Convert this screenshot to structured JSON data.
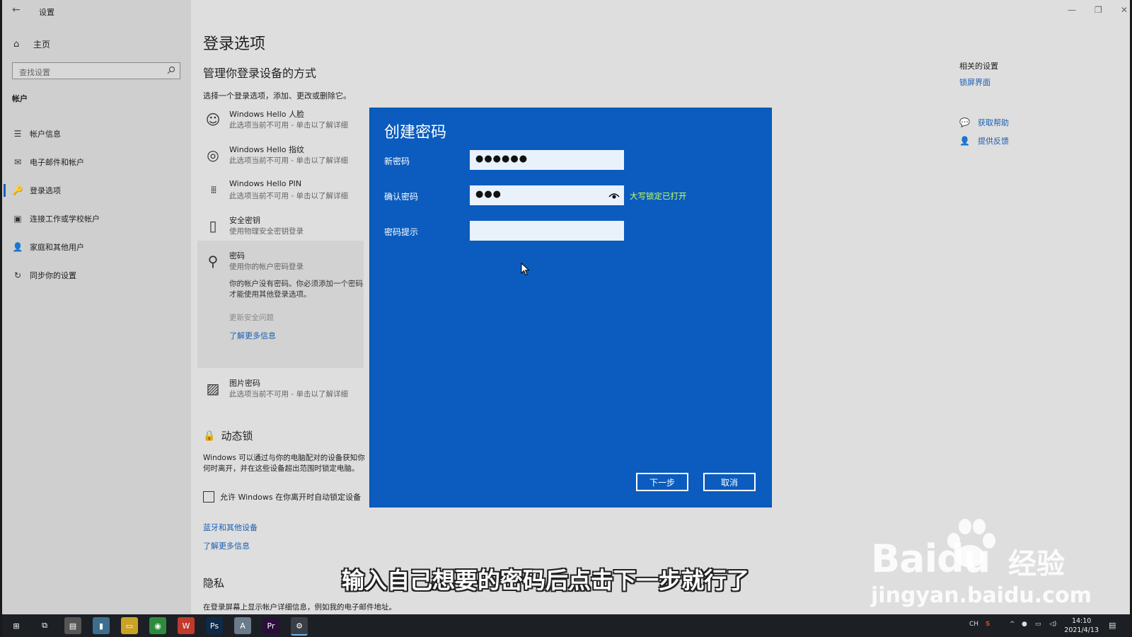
{
  "window": {
    "title": "设置",
    "back_glyph": "←",
    "controls": [
      "—",
      "❐",
      "✕"
    ]
  },
  "sidebar": {
    "home": "主页",
    "search_placeholder": "查找设置",
    "section": "帐户",
    "items": [
      {
        "label": "帐户信息",
        "icon": "account-info-icon",
        "glyph": "☰"
      },
      {
        "label": "电子邮件和帐户",
        "icon": "email-icon",
        "glyph": "✉"
      },
      {
        "label": "登录选项",
        "icon": "key-icon",
        "glyph": "🔑"
      },
      {
        "label": "连接工作或学校帐户",
        "icon": "briefcase-icon",
        "glyph": "▣"
      },
      {
        "label": "家庭和其他用户",
        "icon": "person-icon",
        "glyph": "👤"
      },
      {
        "label": "同步你的设置",
        "icon": "sync-icon",
        "glyph": "↻"
      }
    ]
  },
  "main": {
    "title": "登录选项",
    "subtitle": "管理你登录设备的方式",
    "intro": "选择一个登录选项，添加、更改或删除它。",
    "options": [
      {
        "title": "Windows Hello 人脸",
        "desc": "此选项当前不可用 - 单击以了解详细",
        "icon": "face-icon",
        "glyph": "☺"
      },
      {
        "title": "Windows Hello 指纹",
        "desc": "此选项当前不可用 - 单击以了解详细",
        "icon": "fingerprint-icon",
        "glyph": "◎"
      },
      {
        "title": "Windows Hello PIN",
        "desc": "此选项当前不可用 - 单击以了解详细",
        "icon": "pin-icon",
        "glyph": "⁞⁞⁞"
      },
      {
        "title": "安全密钥",
        "desc": "使用物理安全密钥登录",
        "icon": "usb-key-icon",
        "glyph": "▯"
      },
      {
        "title": "密码",
        "desc": "使用你的帐户密码登录",
        "icon": "password-key-icon",
        "glyph": "⚲"
      },
      {
        "title": "图片密码",
        "desc": "此选项当前不可用 - 单击以了解详细",
        "icon": "picture-icon",
        "glyph": "▨"
      }
    ],
    "password_message": "你的帐户没有密码。你必须添加一个密码才能使用其他登录选项。",
    "password_change": "更新安全问题",
    "password_learn_more": "了解更多信息",
    "dynamic_lock_title": "动态锁",
    "dynamic_lock_desc": "Windows 可以通过与你的电脑配对的设备获知你何时离开，并在这些设备超出范围时锁定电脑。",
    "dynamic_lock_checkbox": "允许 Windows 在你离开时自动锁定设备",
    "bluetooth_link": "蓝牙和其他设备",
    "learn_more_link": "了解更多信息",
    "privacy_title": "隐私",
    "privacy_desc": "在登录屏幕上显示帐户详细信息，例如我的电子邮件地址。"
  },
  "related": {
    "title": "相关的设置",
    "lock_screen": "锁屏界面",
    "get_help": "获取帮助",
    "feedback": "提供反馈"
  },
  "dialog": {
    "title": "创建密码",
    "new_password_label": "新密码",
    "new_password_value": "●●●●●●",
    "confirm_label": "确认密码",
    "confirm_value": "●●●",
    "caps_lock_warning": "大写锁定已打开",
    "hint_label": "密码提示",
    "hint_value": "",
    "next_button": "下一步",
    "cancel_button": "取消"
  },
  "overlay": {
    "subtitle": "输入自己想要的密码后点击下一步就行了",
    "watermark_brand": "Baidu",
    "watermark_jy": "经验",
    "watermark_url": "jingyan.baidu.com"
  },
  "taskbar": {
    "tray_lang": "CH",
    "time": "14:10",
    "date": "2021/4/13",
    "apps": [
      {
        "name": "start-icon",
        "glyph": "⊞",
        "bg": "transparent"
      },
      {
        "name": "task-view-icon",
        "glyph": "⧉",
        "bg": "transparent"
      },
      {
        "name": "app-icon",
        "glyph": "▤",
        "bg": "#555"
      },
      {
        "name": "app-icon-2",
        "glyph": "▮",
        "bg": "#3d6e8f"
      },
      {
        "name": "file-explorer-icon",
        "glyph": "▭",
        "bg": "#c9a227"
      },
      {
        "name": "chrome-icon",
        "glyph": "◉",
        "bg": "#2e8b3e"
      },
      {
        "name": "wps-icon",
        "glyph": "W",
        "bg": "#c0392b"
      },
      {
        "name": "photoshop-icon",
        "glyph": "Ps",
        "bg": "#0d2a48"
      },
      {
        "name": "app-a-icon",
        "glyph": "A",
        "bg": "#6b7b8c"
      },
      {
        "name": "premiere-icon",
        "glyph": "Pr",
        "bg": "#2a0f3a"
      },
      {
        "name": "settings-icon",
        "glyph": "⚙",
        "bg": "#3a3f47"
      }
    ]
  },
  "colors": {
    "dialog_bg": "#0b5cbe",
    "accent_link": "#1a5fb4",
    "caps_warning": "#c8ff5a"
  }
}
